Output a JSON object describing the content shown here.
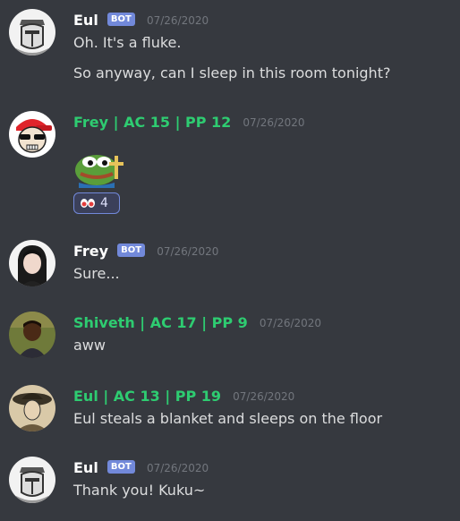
{
  "messages": [
    {
      "author": "Eul",
      "author_color": "#ffffff",
      "is_bot": true,
      "bot_label": "BOT",
      "timestamp": "07/26/2020",
      "avatar": "knight-helmet-avatar",
      "lines": [
        "Oh. It's a fluke.",
        "So anyway, can I sleep in this room tonight?"
      ]
    },
    {
      "author": "Frey | AC 15 | PP 12",
      "author_color": "#2ecc71",
      "is_bot": false,
      "timestamp": "07/26/2020",
      "avatar": "skull-cap-avatar",
      "emoji": "pepe-frog-emoji",
      "reaction": {
        "emoji": "eyes-emoji",
        "count": "4"
      }
    },
    {
      "author": "Frey",
      "author_color": "#ffffff",
      "is_bot": true,
      "bot_label": "BOT",
      "timestamp": "07/26/2020",
      "avatar": "dark-hair-girl-avatar",
      "lines": [
        "Sure..."
      ]
    },
    {
      "author": "Shiveth | AC 17 | PP 9",
      "author_color": "#2ecc71",
      "is_bot": false,
      "timestamp": "07/26/2020",
      "avatar": "child-photo-avatar",
      "lines": [
        "aww"
      ]
    },
    {
      "author": "Eul | AC 13 | PP 19",
      "author_color": "#2ecc71",
      "is_bot": false,
      "timestamp": "07/26/2020",
      "avatar": "hat-character-avatar",
      "lines": [
        "Eul steals a blanket and sleeps on the floor"
      ]
    },
    {
      "author": "Eul",
      "author_color": "#ffffff",
      "is_bot": true,
      "bot_label": "BOT",
      "timestamp": "07/26/2020",
      "avatar": "knight-helmet-avatar",
      "lines": [
        "Thank you! Kuku~"
      ]
    }
  ]
}
